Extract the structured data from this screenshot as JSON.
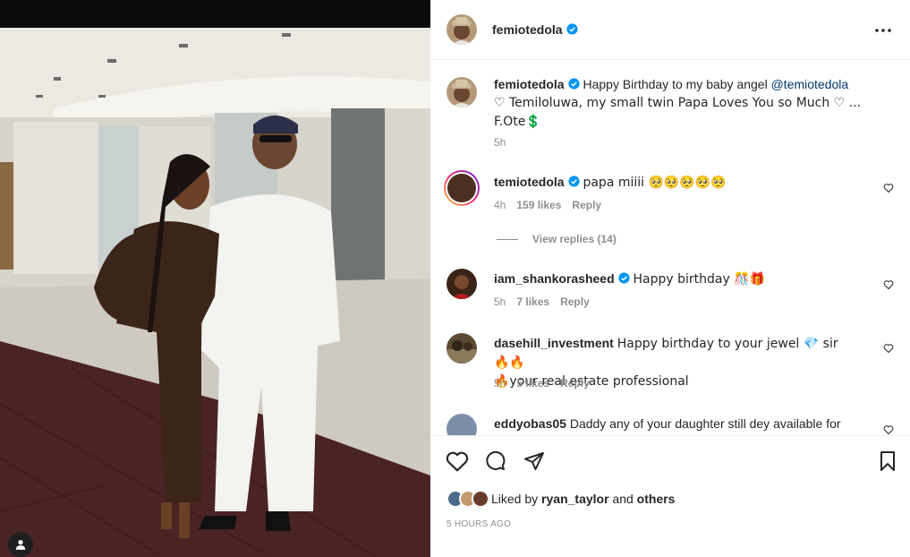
{
  "post": {
    "author": "femiotedola",
    "caption_author": "femiotedola",
    "caption_text": "Happy Birthday to my baby angel",
    "caption_mention": "@temiotedola",
    "caption_line2": "♡ Temiloluwa, my small twin Papa Loves You so Much ♡ ...",
    "caption_line3": "F.Ote💲",
    "caption_time": "5h",
    "time_ago": "5 HOURS AGO"
  },
  "comments": [
    {
      "user": "temiotedola",
      "text": "papa miiii 🥺🥺🥺🥺🥺",
      "time": "4h",
      "likes": "159 likes",
      "reply": "Reply"
    },
    {
      "user": "iam_shankorasheed",
      "text": "Happy birthday 🎊🎁",
      "time": "5h",
      "likes": "7 likes",
      "reply": "Reply"
    },
    {
      "user": "dasehill_investment",
      "text": "Happy birthday to your jewel 💎 sir 🔥🔥",
      "text2": "🔥your real estate professional",
      "time": "5h",
      "likes": "5 likes",
      "reply": "Reply"
    },
    {
      "user": "eddyobas05",
      "text": "Daddy any of your daughter still dey available for"
    }
  ],
  "view_replies": "View replies (14)",
  "likes": {
    "prefix": "Liked by",
    "user": "ryan_taylor",
    "and": "and",
    "others": "others"
  },
  "icons": [
    "more-icon",
    "like-icon",
    "comment-icon",
    "share-icon",
    "save-icon",
    "heart-small-icon",
    "verified-icon",
    "user-tag-icon"
  ],
  "colors": {
    "accent": "#0095f6",
    "link": "#00376b",
    "muted": "#8e8e8e",
    "text": "#262626"
  }
}
